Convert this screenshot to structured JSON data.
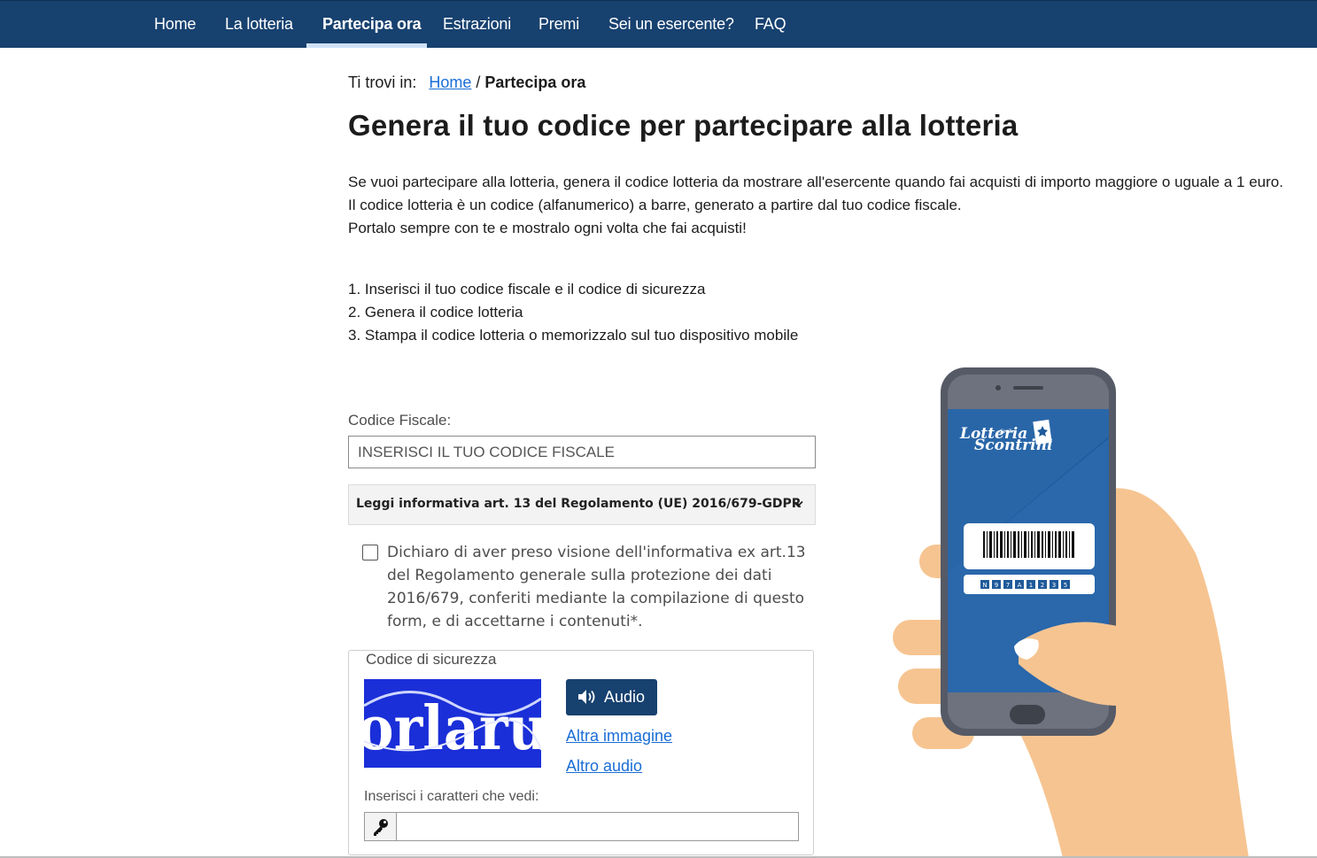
{
  "nav": {
    "items": [
      {
        "label": "Home",
        "active": false
      },
      {
        "label": "La lotteria",
        "active": false
      },
      {
        "label": "Partecipa ora",
        "active": true
      },
      {
        "label": "Estrazioni",
        "active": false
      },
      {
        "label": "Premi",
        "active": false
      },
      {
        "label": "Sei un esercente?",
        "active": false
      },
      {
        "label": "FAQ",
        "active": false
      }
    ]
  },
  "breadcrumb": {
    "prefix": "Ti trovi in:",
    "home": "Home",
    "separator": "/",
    "current": "Partecipa ora"
  },
  "page_title": "Genera il tuo codice per partecipare alla lotteria",
  "intro": {
    "p1": "Se vuoi partecipare alla lotteria, genera il codice lotteria da mostrare all'esercente quando fai acquisti di importo maggiore o uguale a 1 euro.",
    "p2": "Il codice lotteria è un codice (alfanumerico) a barre, generato a partire dal tuo codice fiscale.",
    "p3": "Portalo sempre con te e mostralo ogni volta che fai acquisti!"
  },
  "steps": [
    "1. Inserisci il tuo codice fiscale e il codice di sicurezza",
    "2. Genera il codice lotteria",
    "3. Stampa il codice lotteria o memorizzalo sul tuo dispositivo mobile"
  ],
  "form": {
    "cf_label": "Codice Fiscale:",
    "cf_placeholder": "INSERISCI IL TUO CODICE FISCALE",
    "gdpr_title": "Leggi informativa art. 13 del Regolamento (UE) 2016/679-GDPR",
    "consent_text": "Dichiaro di aver preso visione dell'informativa ex art.13 del Regolamento generale sulla protezione dei dati 2016/679, conferiti mediante la compilazione di questo form, e di accettarne i contenuti*.",
    "consent_checked": false,
    "captcha": {
      "legend": "Codice di sicurezza",
      "image_text": "orlaru",
      "audio_button": "Audio",
      "other_image": "Altra immagine",
      "other_audio": "Altro audio",
      "input_label": "Inserisci i caratteri che vedi:",
      "input_value": ""
    }
  },
  "illustration": {
    "app_logo_text": "Lotteria degli Scontrini",
    "logo_line1": "Lotteria",
    "logo_small": "degli",
    "logo_line2": "Scontrini",
    "code_chars": [
      "N",
      "9",
      "7",
      "A",
      "1",
      "2",
      "3",
      "5"
    ]
  },
  "colors": {
    "nav_bg": "#17416f",
    "link": "#1a6ed6",
    "button_bg": "#17416f",
    "captcha_bg": "#1a2fd8"
  },
  "icons": {
    "accordion": "chevron-down-icon",
    "audio": "speaker-icon",
    "key": "key-icon"
  }
}
